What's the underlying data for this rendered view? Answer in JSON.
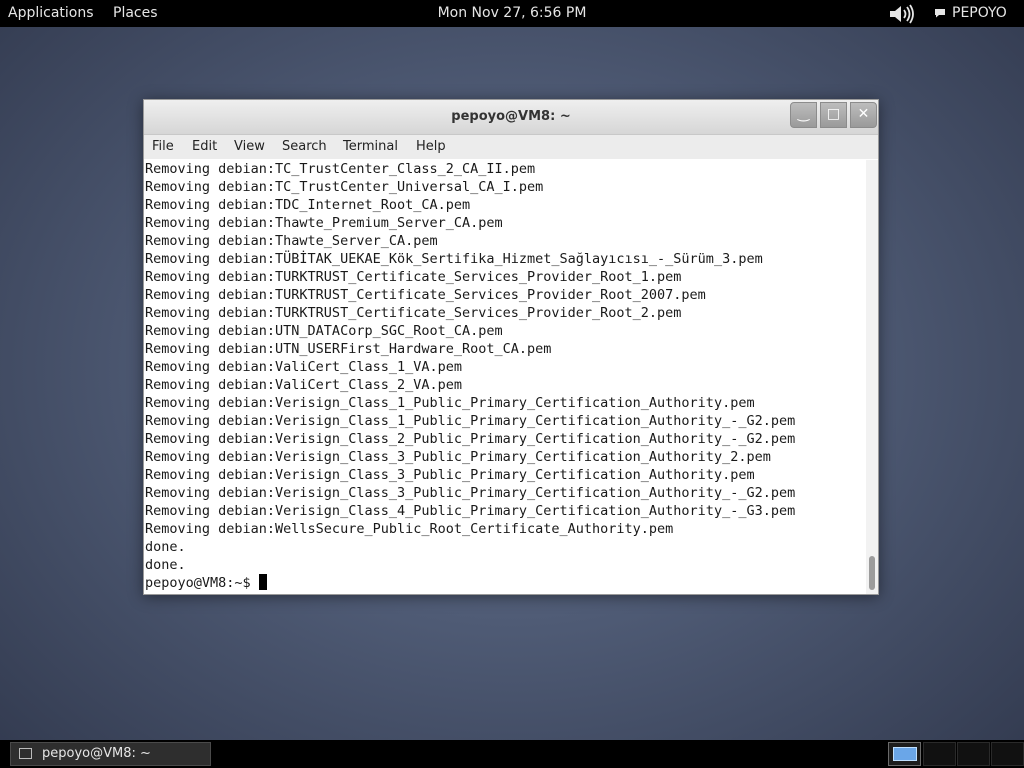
{
  "topbar": {
    "applications": "Applications",
    "places": "Places",
    "clock": "Mon Nov 27,  6:56 PM",
    "user": "PEPOYO"
  },
  "window": {
    "title": "pepoyo@VM8: ~",
    "controls": {
      "minimize": "‿",
      "maximize": "□",
      "close": "✕"
    },
    "menu": [
      "File",
      "Edit",
      "View",
      "Search",
      "Terminal",
      "Help"
    ]
  },
  "terminal": {
    "lines": [
      "Removing debian:TC_TrustCenter_Class_2_CA_II.pem",
      "Removing debian:TC_TrustCenter_Universal_CA_I.pem",
      "Removing debian:TDC_Internet_Root_CA.pem",
      "Removing debian:Thawte_Premium_Server_CA.pem",
      "Removing debian:Thawte_Server_CA.pem",
      "Removing debian:TÜBİTAK_UEKAE_Kök_Sertifika_Hizmet_Sağlayıcısı_-_Sürüm_3.pem",
      "Removing debian:TURKTRUST_Certificate_Services_Provider_Root_1.pem",
      "Removing debian:TURKTRUST_Certificate_Services_Provider_Root_2007.pem",
      "Removing debian:TURKTRUST_Certificate_Services_Provider_Root_2.pem",
      "Removing debian:UTN_DATACorp_SGC_Root_CA.pem",
      "Removing debian:UTN_USERFirst_Hardware_Root_CA.pem",
      "Removing debian:ValiCert_Class_1_VA.pem",
      "Removing debian:ValiCert_Class_2_VA.pem",
      "Removing debian:Verisign_Class_1_Public_Primary_Certification_Authority.pem",
      "Removing debian:Verisign_Class_1_Public_Primary_Certification_Authority_-_G2.pem",
      "Removing debian:Verisign_Class_2_Public_Primary_Certification_Authority_-_G2.pem",
      "Removing debian:Verisign_Class_3_Public_Primary_Certification_Authority_2.pem",
      "Removing debian:Verisign_Class_3_Public_Primary_Certification_Authority.pem",
      "Removing debian:Verisign_Class_3_Public_Primary_Certification_Authority_-_G2.pem",
      "Removing debian:Verisign_Class_4_Public_Primary_Certification_Authority_-_G3.pem",
      "Removing debian:WellsSecure_Public_Root_Certificate_Authority.pem",
      "done.",
      "done."
    ],
    "prompt": "pepoyo@VM8:~$ "
  },
  "taskbar": {
    "window_label": "pepoyo@VM8: ~"
  },
  "icons": {
    "volume": "speaker-icon",
    "chat": "chat-bubble-icon",
    "terminal": "terminal-icon"
  },
  "colors": {
    "panel": "#000000",
    "desktop": "#4f5b75",
    "workspace_active": "#6aa6e8"
  }
}
